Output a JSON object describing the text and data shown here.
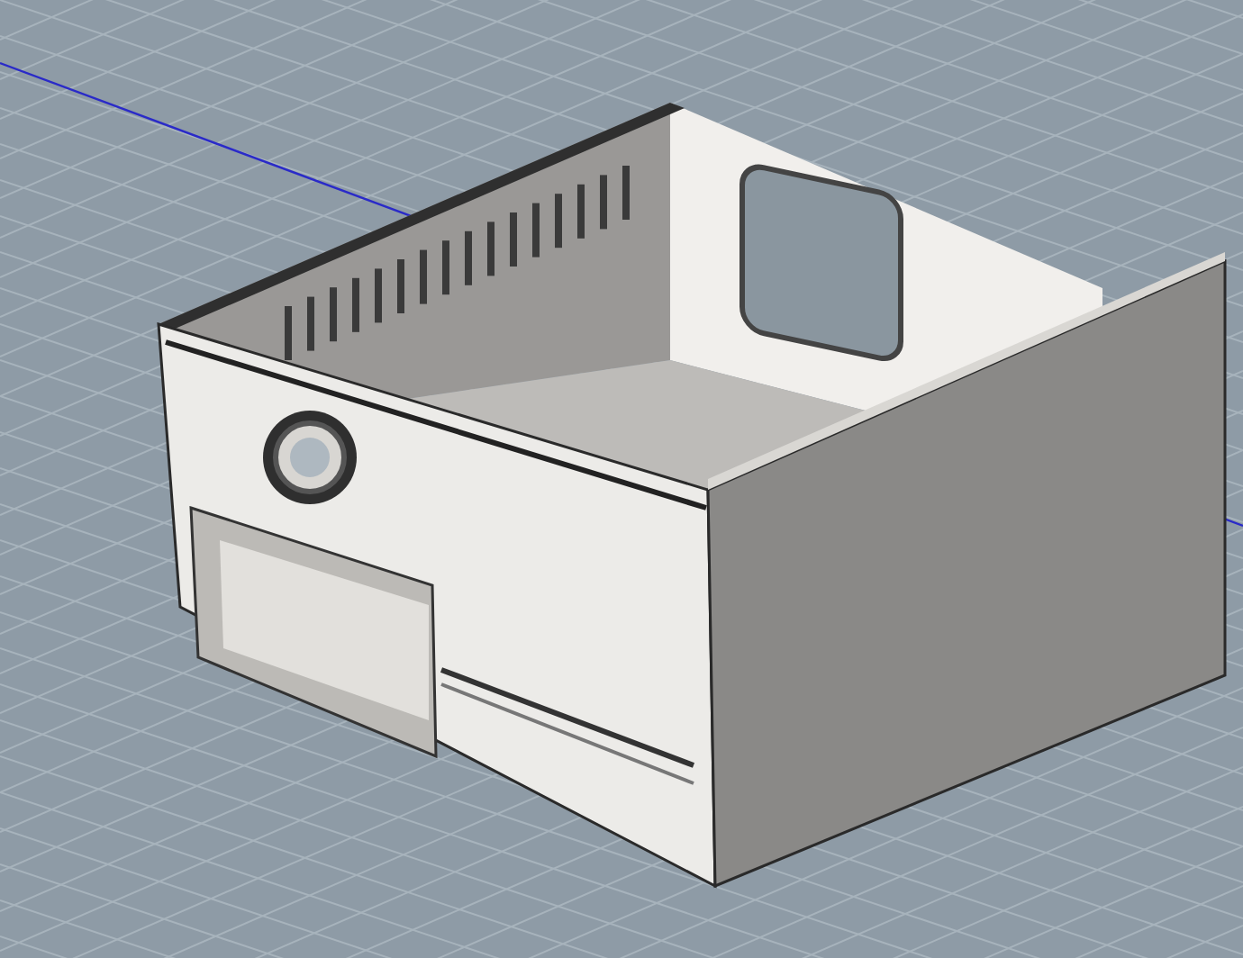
{
  "viewport": {
    "grid": true,
    "axis_line": true
  }
}
